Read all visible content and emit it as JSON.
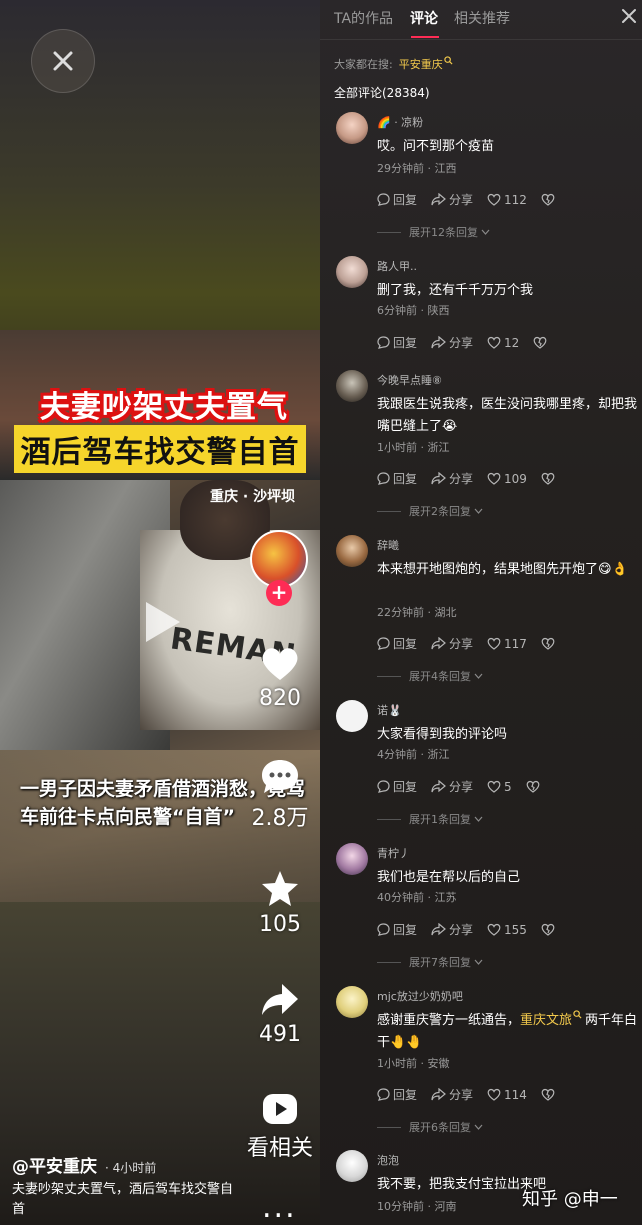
{
  "video": {
    "caption_line1": "夫妻吵架丈夫置气",
    "caption_line2": "酒后驾车找交警自首",
    "location": "重庆 · 沙坪坝",
    "shirt_text": "REMAN",
    "bottom_caption": "一男子因夫妻矛盾借酒消愁，竟驾车前往卡点向民警“自首”",
    "avatar_badge": "+",
    "likes": "820",
    "comments": "2.8万",
    "favorites": "105",
    "shares": "491",
    "related_label": "看相关",
    "more_label": "...",
    "author": "@平安重庆",
    "post_time": "· 4小时前",
    "description": "夫妻吵架丈夫置气，酒后驾车找交警自首"
  },
  "comments_panel": {
    "tabs": [
      "TA的作品",
      "评论",
      "相关推荐"
    ],
    "active_tab": 1,
    "search_prefix": "大家都在搜:",
    "search_term": "平安重庆",
    "total": "全部评论(28384)",
    "reply_label": "回复",
    "share_label": "分享",
    "items": [
      {
        "name": "🌈 · 凉粉",
        "text": "哎。问不到那个疫苗",
        "meta": "29分钟前 · 江西",
        "likes": "112",
        "expand": "展开12条回复"
      },
      {
        "name": "路人甲..",
        "text": "删了我，还有千千万万个我",
        "meta": "6分钟前 · 陕西",
        "likes": "12",
        "expand": ""
      },
      {
        "name": "今晚早点睡⑧",
        "text": "我跟医生说我疼，医生没问我哪里疼，却把我嘴巴缝上了😭",
        "meta": "1小时前 · 浙江",
        "likes": "109",
        "expand": "展开2条回复"
      },
      {
        "name": "辞曦",
        "text": "本来想开地图炮的，结果地图先开炮了😋👌",
        "meta": "22分钟前 · 湖北",
        "likes": "117",
        "expand": "展开4条回复"
      },
      {
        "name": "诺🐰",
        "text": "大家看得到我的评论吗",
        "meta": "4分钟前 · 浙江",
        "likes": "5",
        "expand": "展开1条回复"
      },
      {
        "name": "青柠丿",
        "text": "我们也是在帮以后的自己",
        "meta": "40分钟前 · 江苏",
        "likes": "155",
        "expand": "展开7条回复"
      },
      {
        "name": "mjc放过少奶奶吧",
        "text_before": "感谢重庆警方一纸通告，",
        "text_link": "重庆文旅",
        "text_after": "两千年白干🤚🤚",
        "meta": "1小时前 · 安徽",
        "likes": "114",
        "expand": "展开6条回复"
      },
      {
        "name": "泡泡",
        "text": "我不要，把我支付宝拉出来吧",
        "meta": "10分钟前 · 河南",
        "likes": "",
        "expand": ""
      }
    ]
  },
  "watermark": "知乎 @申一",
  "colors": {
    "accent": "#fe2c55",
    "highlight": "#f2c94c",
    "caption_yellow": "#f6d52b",
    "caption_red": "#d11"
  }
}
